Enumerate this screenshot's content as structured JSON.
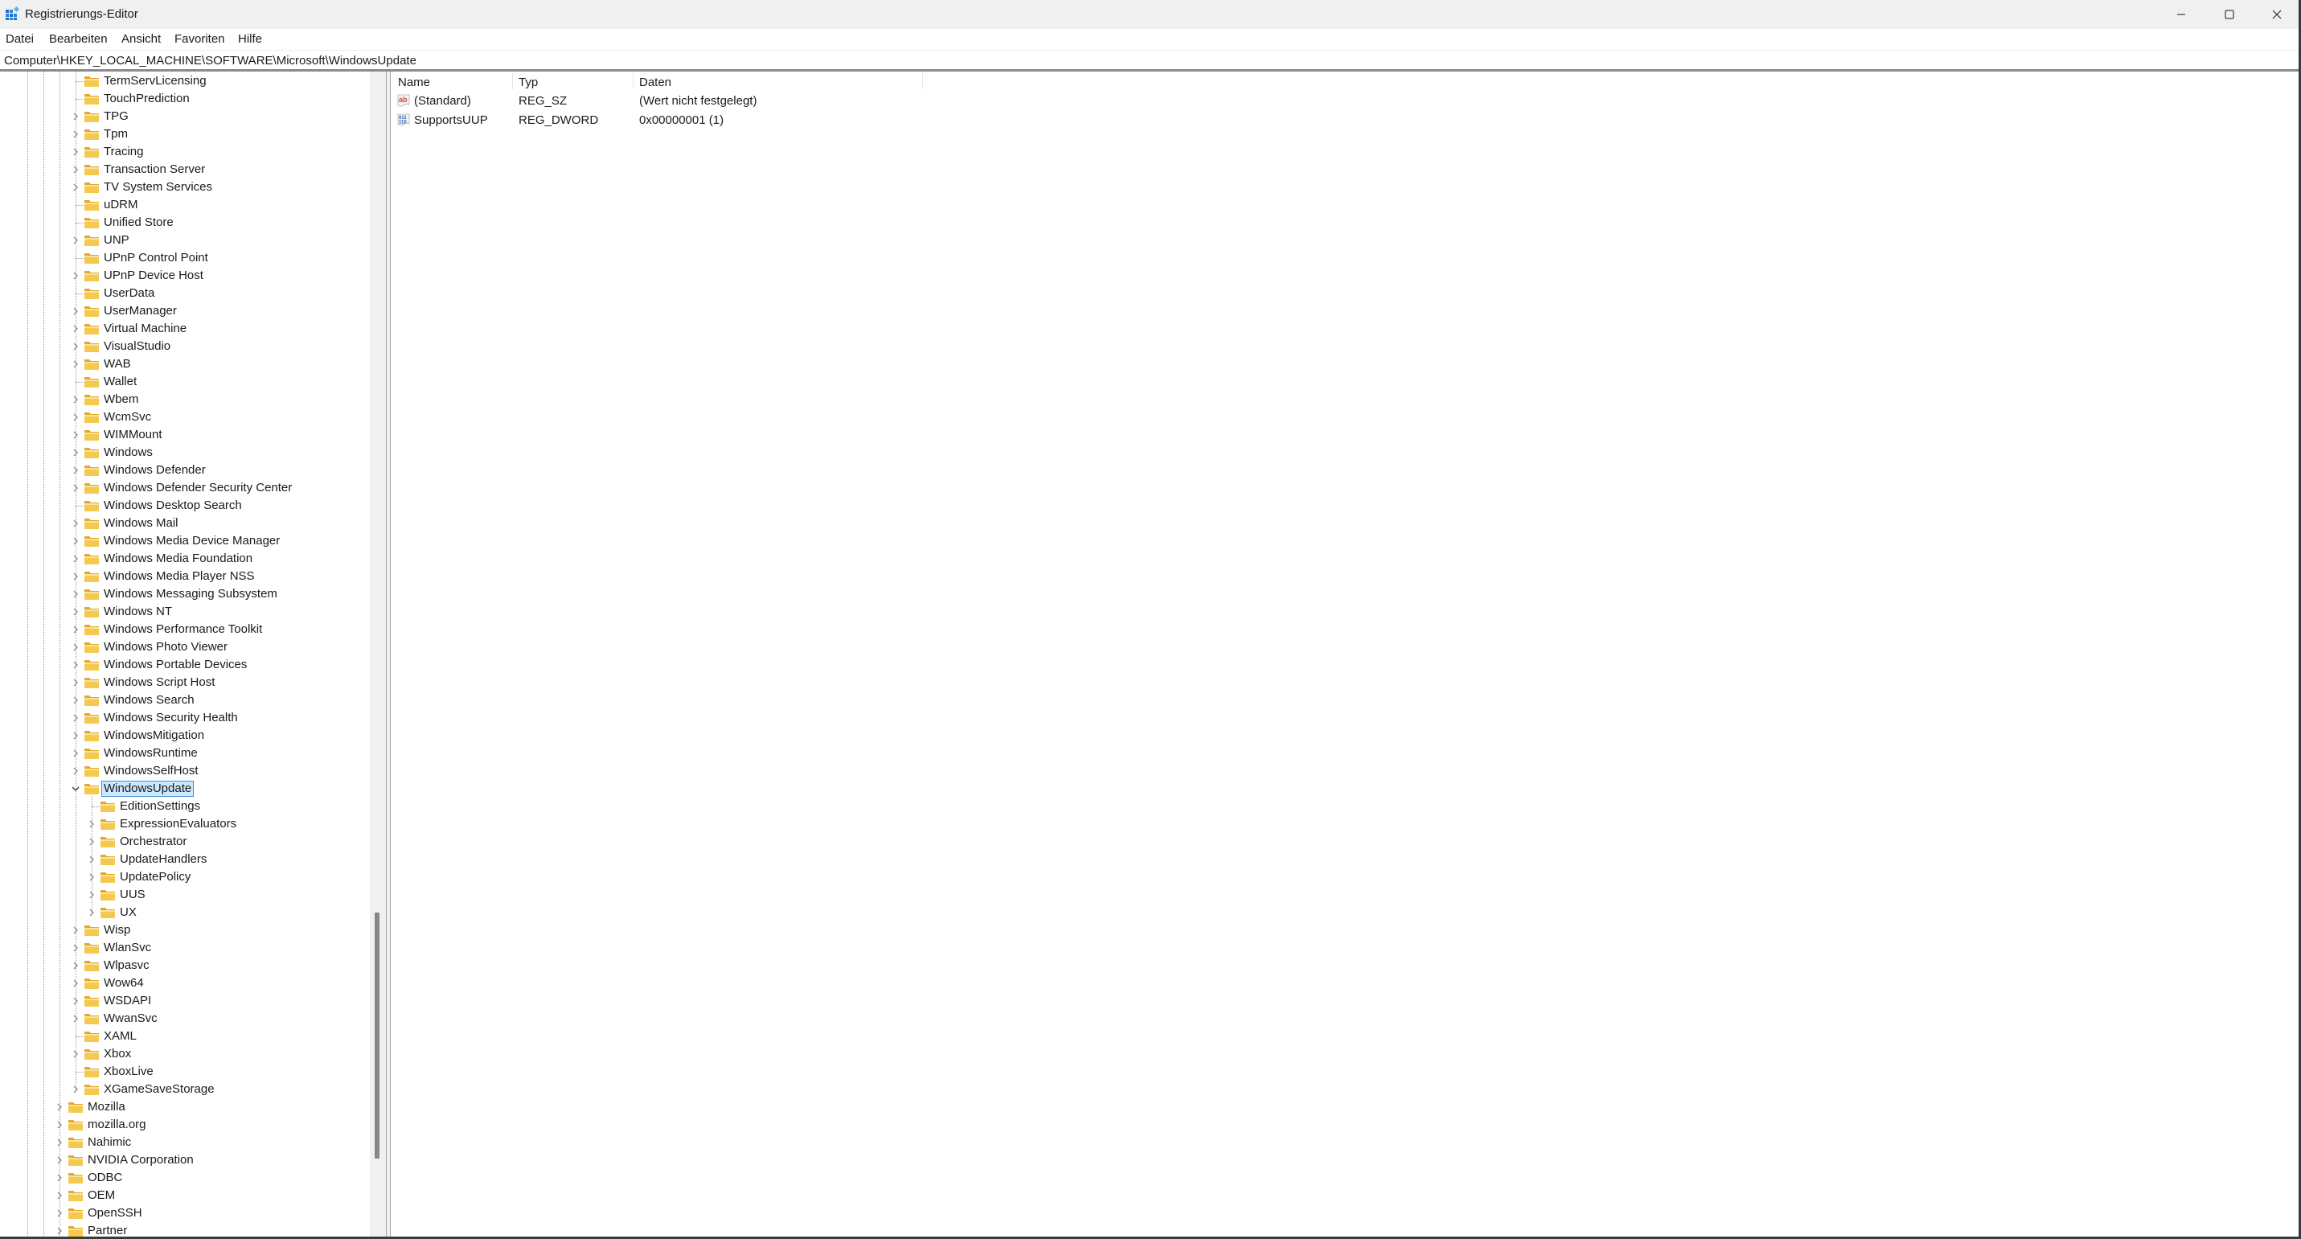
{
  "window": {
    "title": "Registrierungs-Editor",
    "app_icon": "registry-editor-icon",
    "controls": [
      "minimize",
      "maximize",
      "close"
    ]
  },
  "menu": [
    {
      "label": "Datei"
    },
    {
      "label": "Bearbeiten"
    },
    {
      "label": "Ansicht"
    },
    {
      "label": "Favoriten"
    },
    {
      "label": "Hilfe"
    }
  ],
  "address": "Computer\\HKEY_LOCAL_MACHINE\\SOFTWARE\\Microsoft\\WindowsUpdate",
  "tree": {
    "items": [
      {
        "label": "TermServLicensing",
        "level": 3,
        "expandable": false
      },
      {
        "label": "TouchPrediction",
        "level": 3,
        "expandable": false
      },
      {
        "label": "TPG",
        "level": 3,
        "expandable": true
      },
      {
        "label": "Tpm",
        "level": 3,
        "expandable": true
      },
      {
        "label": "Tracing",
        "level": 3,
        "expandable": true
      },
      {
        "label": "Transaction Server",
        "level": 3,
        "expandable": true
      },
      {
        "label": "TV System Services",
        "level": 3,
        "expandable": true
      },
      {
        "label": "uDRM",
        "level": 3,
        "expandable": false
      },
      {
        "label": "Unified Store",
        "level": 3,
        "expandable": false
      },
      {
        "label": "UNP",
        "level": 3,
        "expandable": true
      },
      {
        "label": "UPnP Control Point",
        "level": 3,
        "expandable": false
      },
      {
        "label": "UPnP Device Host",
        "level": 3,
        "expandable": true
      },
      {
        "label": "UserData",
        "level": 3,
        "expandable": false
      },
      {
        "label": "UserManager",
        "level": 3,
        "expandable": true
      },
      {
        "label": "Virtual Machine",
        "level": 3,
        "expandable": true
      },
      {
        "label": "VisualStudio",
        "level": 3,
        "expandable": true
      },
      {
        "label": "WAB",
        "level": 3,
        "expandable": true
      },
      {
        "label": "Wallet",
        "level": 3,
        "expandable": false
      },
      {
        "label": "Wbem",
        "level": 3,
        "expandable": true
      },
      {
        "label": "WcmSvc",
        "level": 3,
        "expandable": true
      },
      {
        "label": "WIMMount",
        "level": 3,
        "expandable": true
      },
      {
        "label": "Windows",
        "level": 3,
        "expandable": true
      },
      {
        "label": "Windows Defender",
        "level": 3,
        "expandable": true
      },
      {
        "label": "Windows Defender Security Center",
        "level": 3,
        "expandable": true
      },
      {
        "label": "Windows Desktop Search",
        "level": 3,
        "expandable": false
      },
      {
        "label": "Windows Mail",
        "level": 3,
        "expandable": true
      },
      {
        "label": "Windows Media Device Manager",
        "level": 3,
        "expandable": true
      },
      {
        "label": "Windows Media Foundation",
        "level": 3,
        "expandable": true
      },
      {
        "label": "Windows Media Player NSS",
        "level": 3,
        "expandable": true
      },
      {
        "label": "Windows Messaging Subsystem",
        "level": 3,
        "expandable": true
      },
      {
        "label": "Windows NT",
        "level": 3,
        "expandable": true
      },
      {
        "label": "Windows Performance Toolkit",
        "level": 3,
        "expandable": true
      },
      {
        "label": "Windows Photo Viewer",
        "level": 3,
        "expandable": true
      },
      {
        "label": "Windows Portable Devices",
        "level": 3,
        "expandable": true
      },
      {
        "label": "Windows Script Host",
        "level": 3,
        "expandable": true
      },
      {
        "label": "Windows Search",
        "level": 3,
        "expandable": true
      },
      {
        "label": "Windows Security Health",
        "level": 3,
        "expandable": true
      },
      {
        "label": "WindowsMitigation",
        "level": 3,
        "expandable": true
      },
      {
        "label": "WindowsRuntime",
        "level": 3,
        "expandable": true
      },
      {
        "label": "WindowsSelfHost",
        "level": 3,
        "expandable": true
      },
      {
        "label": "WindowsUpdate",
        "level": 3,
        "expandable": true,
        "expanded": true,
        "selected": true
      },
      {
        "label": "EditionSettings",
        "level": 4,
        "expandable": false
      },
      {
        "label": "ExpressionEvaluators",
        "level": 4,
        "expandable": true
      },
      {
        "label": "Orchestrator",
        "level": 4,
        "expandable": true
      },
      {
        "label": "UpdateHandlers",
        "level": 4,
        "expandable": true
      },
      {
        "label": "UpdatePolicy",
        "level": 4,
        "expandable": true
      },
      {
        "label": "UUS",
        "level": 4,
        "expandable": true
      },
      {
        "label": "UX",
        "level": 4,
        "expandable": true
      },
      {
        "label": "Wisp",
        "level": 3,
        "expandable": true
      },
      {
        "label": "WlanSvc",
        "level": 3,
        "expandable": true
      },
      {
        "label": "Wlpasvc",
        "level": 3,
        "expandable": true
      },
      {
        "label": "Wow64",
        "level": 3,
        "expandable": true
      },
      {
        "label": "WSDAPI",
        "level": 3,
        "expandable": true
      },
      {
        "label": "WwanSvc",
        "level": 3,
        "expandable": true
      },
      {
        "label": "XAML",
        "level": 3,
        "expandable": false
      },
      {
        "label": "Xbox",
        "level": 3,
        "expandable": true
      },
      {
        "label": "XboxLive",
        "level": 3,
        "expandable": false
      },
      {
        "label": "XGameSaveStorage",
        "level": 3,
        "expandable": true
      },
      {
        "label": "Mozilla",
        "level": 2,
        "expandable": true
      },
      {
        "label": "mozilla.org",
        "level": 2,
        "expandable": true
      },
      {
        "label": "Nahimic",
        "level": 2,
        "expandable": true
      },
      {
        "label": "NVIDIA Corporation",
        "level": 2,
        "expandable": true
      },
      {
        "label": "ODBC",
        "level": 2,
        "expandable": true
      },
      {
        "label": "OEM",
        "level": 2,
        "expandable": true
      },
      {
        "label": "OpenSSH",
        "level": 2,
        "expandable": true
      },
      {
        "label": "Partner",
        "level": 2,
        "expandable": true
      }
    ],
    "scroll_position_fraction": 0.72
  },
  "values": {
    "columns": [
      {
        "label": "Name"
      },
      {
        "label": "Typ"
      },
      {
        "label": "Daten"
      }
    ],
    "rows": [
      {
        "name": "(Standard)",
        "type": "REG_SZ",
        "data": "(Wert nicht festgelegt)",
        "icon": "string-value-icon"
      },
      {
        "name": "SupportsUUP",
        "type": "REG_DWORD",
        "data": "0x00000001 (1)",
        "icon": "binary-value-icon"
      }
    ]
  },
  "colors": {
    "folder": "#f5c850",
    "selection_bg": "#cce8ff",
    "selection_border": "#3d8fd6",
    "titlebar_bg": "#f0f0f0"
  }
}
